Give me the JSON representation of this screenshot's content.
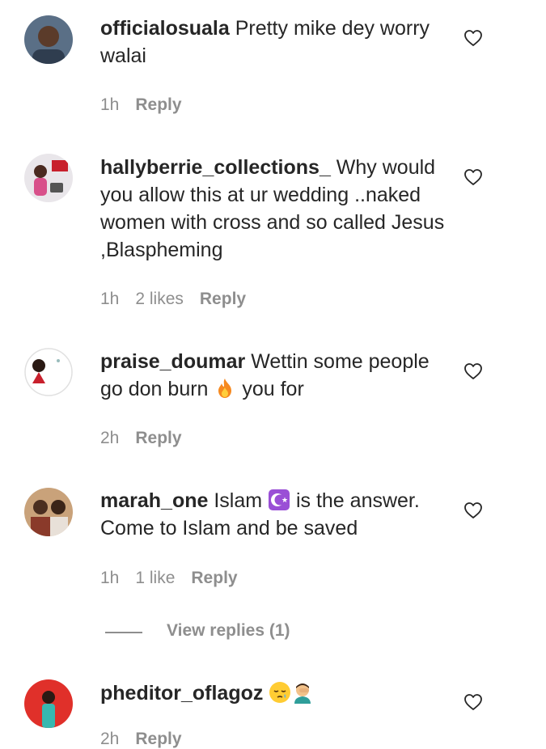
{
  "comments": [
    {
      "username": "officialosuala",
      "text": " Pretty mike dey worry walai",
      "time": "1h",
      "likes": "",
      "reply": "Reply"
    },
    {
      "username": "hallyberrie_collections_",
      "text": " Why would you allow this at ur wedding ..naked women with cross and so called Jesus ,Blaspheming",
      "time": "1h",
      "likes": "2 likes",
      "reply": "Reply"
    },
    {
      "username": "praise_doumar",
      "text_before": " Wettin some people go don burn ",
      "text_after": " you for",
      "emoji": "fire",
      "time": "2h",
      "likes": "",
      "reply": "Reply"
    },
    {
      "username": "marah_one",
      "text_before": " Islam ",
      "text_after": " is the answer. Come to Islam and be saved",
      "emoji": "star-and-crescent",
      "time": "1h",
      "likes": "1 like",
      "reply": "Reply"
    },
    {
      "username": "pheditor_oflagoz",
      "emojis": [
        "sleepy-face",
        "man-facepalming"
      ],
      "time": "2h",
      "reply": "Reply"
    }
  ],
  "view_replies": "View replies (1)",
  "colors": {
    "text": "#262626",
    "secondary": "#8e8e8e",
    "background": "#ffffff"
  }
}
